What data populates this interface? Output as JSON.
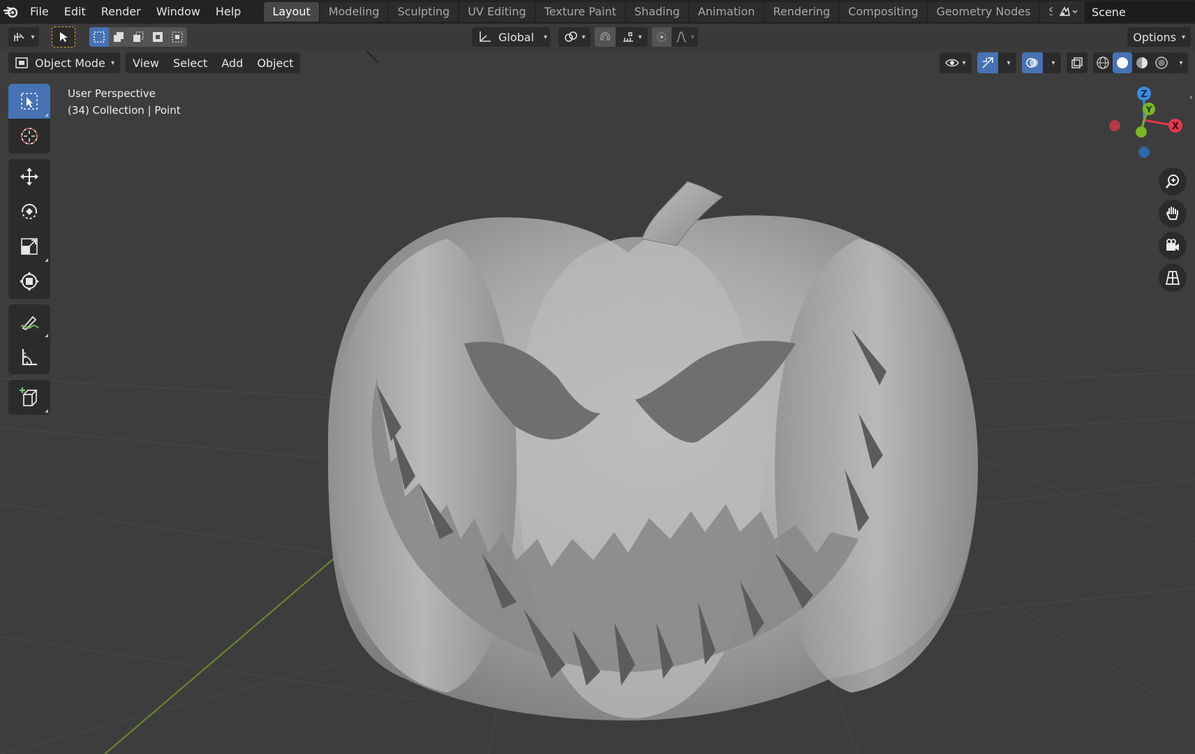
{
  "menubar": {
    "items": [
      "File",
      "Edit",
      "Render",
      "Window",
      "Help"
    ]
  },
  "workspaces": {
    "tabs": [
      "Layout",
      "Modeling",
      "Sculpting",
      "UV Editing",
      "Texture Paint",
      "Shading",
      "Animation",
      "Rendering",
      "Compositing",
      "Geometry Nodes",
      "Scripting"
    ],
    "active": "Layout"
  },
  "scene": {
    "name": "Scene"
  },
  "toolheader": {
    "transform_orientation": "Global",
    "options_label": "Options"
  },
  "viewport_header": {
    "mode": "Object Mode",
    "menus": [
      "View",
      "Select",
      "Add",
      "Object"
    ]
  },
  "overlay": {
    "perspective": "User Perspective",
    "collection": "(34) Collection | Point"
  },
  "gizmo": {
    "z": "Z",
    "y": "Y",
    "x": "X"
  },
  "colors": {
    "accent": "#4772b3",
    "axis_x": "#e0394f",
    "axis_y": "#7ab528",
    "axis_z": "#3b8ce0",
    "grid_line": "#4a4a4a",
    "y_axis_line": "#6a8d2b"
  },
  "icons": {
    "left_toolbar": [
      "select-box-icon",
      "cursor-icon",
      "move-icon",
      "rotate-icon",
      "scale-icon",
      "transform-icon",
      "annotate-icon",
      "measure-icon",
      "add-cube-icon"
    ],
    "navigation": [
      "zoom-icon",
      "pan-hand-icon",
      "camera-view-icon",
      "grid-ortho-icon"
    ]
  }
}
